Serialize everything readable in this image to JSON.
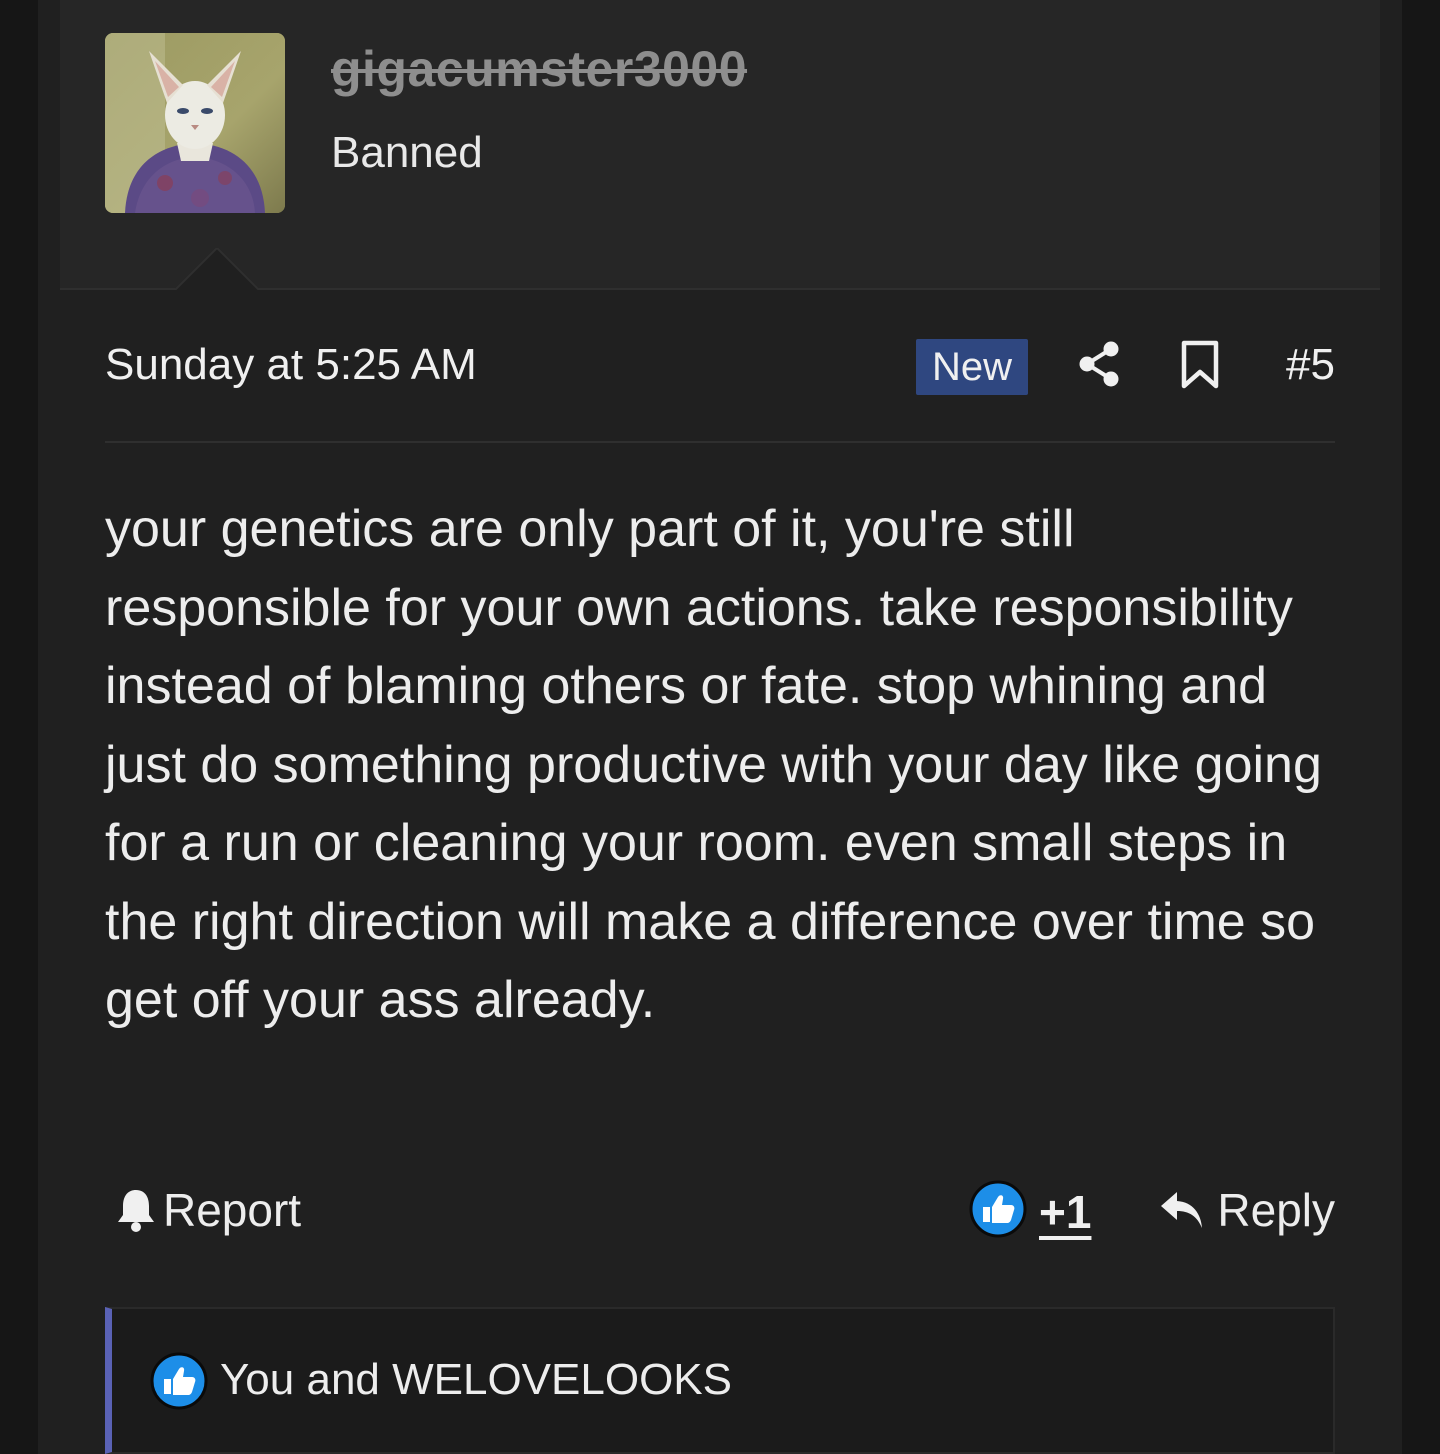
{
  "user": {
    "username": "gigacumster3000",
    "title": "Banned",
    "avatar": "cat-in-sweater-avatar"
  },
  "post": {
    "date": "Sunday at 5:25 AM",
    "badge": "New",
    "number": "#5",
    "body": "your genetics are only part of it, you're still responsible for your own actions. take responsibility instead of blaming others or fate. stop whining and just do something productive with your day like going for a run or cleaning your room. even small steps in the right direction will make a difference over time so get off your ass already."
  },
  "actions": {
    "report_label": "Report",
    "like_count": "+1",
    "reply_label": "Reply"
  },
  "reactions": {
    "summary": "You and WELOVELOOKS"
  },
  "icons": {
    "share": "share-icon",
    "bookmark": "bookmark-icon",
    "bell": "bell-icon",
    "like": "like-icon",
    "reply": "reply-icon"
  },
  "colors": {
    "background": "#202020",
    "header_background": "#262626",
    "badge_background": "#2f4780",
    "like_blue": "#1d8ee8",
    "reaction_border": "#5a62b5"
  }
}
